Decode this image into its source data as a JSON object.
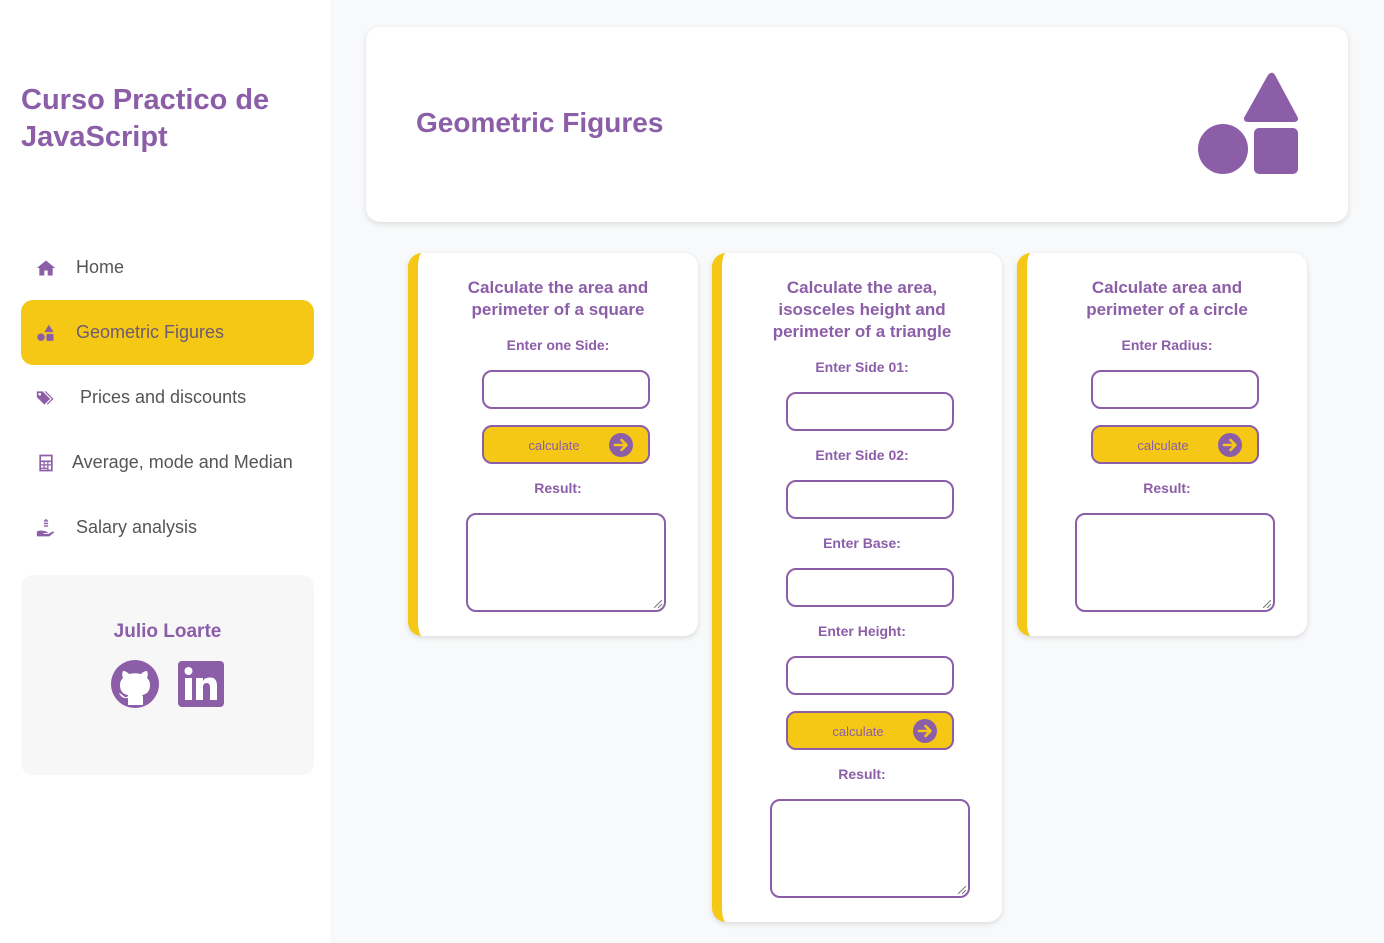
{
  "sidebar": {
    "brand": "Curso Practico de JavaScript",
    "items": [
      {
        "label": "Home",
        "icon": "home-icon"
      },
      {
        "label": "Geometric Figures",
        "icon": "shapes-icon"
      },
      {
        "label": "Prices and discounts",
        "icon": "tags-icon"
      },
      {
        "label": "Average, mode and Median",
        "icon": "calculator-icon"
      },
      {
        "label": "Salary analysis",
        "icon": "hand-holding-dollar-icon"
      }
    ],
    "profile": {
      "name": "Julio Loarte",
      "links": [
        "github-icon",
        "linkedin-icon"
      ]
    }
  },
  "header": {
    "title": "Geometric Figures",
    "icon": "shapes-icon"
  },
  "cards": {
    "square": {
      "title": "Calculate the area and perimeter of a square",
      "side_label": "Enter one Side:",
      "button_label": "calculate",
      "result_label": "Result:"
    },
    "triangle": {
      "title": "Calculate the area, isosceles height and perimeter of a triangle",
      "side1_label": "Enter Side 01:",
      "side2_label": "Enter Side 02:",
      "base_label": "Enter Base:",
      "height_label": "Enter Height:",
      "button_label": "calculate",
      "result_label": "Result:"
    },
    "circle": {
      "title": "Calculate area and perimeter of a circle",
      "radius_label": "Enter Radius:",
      "button_label": "calculate",
      "result_label": "Result:"
    }
  },
  "colors": {
    "accent": "#8c5ea8",
    "highlight": "#f5c816",
    "background": "#f8f9fa",
    "text_muted": "#555555"
  }
}
